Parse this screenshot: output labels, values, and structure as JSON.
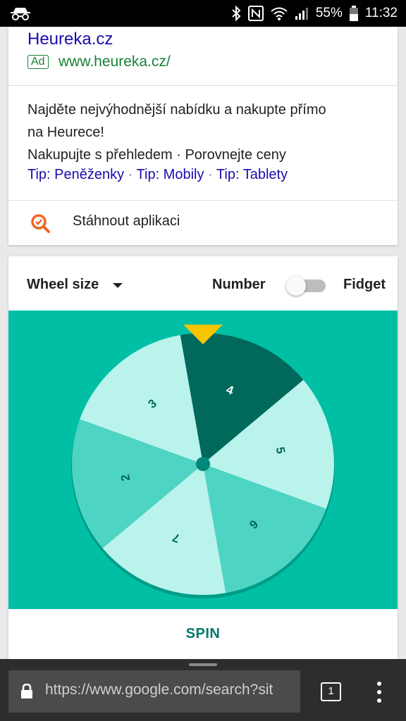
{
  "status_bar": {
    "battery": "55%",
    "time": "11:32",
    "icons": [
      "incognito-icon",
      "bluetooth-icon",
      "nfc-icon",
      "wifi-icon",
      "signal-icon",
      "battery-icon"
    ]
  },
  "ad": {
    "title": "Heureka.cz",
    "badge": "Ad",
    "url": "www.heureka.cz/",
    "description": [
      "Najděte nejvýhodnější nabídku a nakupte přímo",
      "na Heurece!",
      "Nakupujte s přehledem · Porovnejte ceny"
    ],
    "links": [
      "Tip: Peněženky",
      "Tip: Mobily",
      "Tip: Tablety"
    ],
    "link_separator": " · ",
    "app_link": "Stáhnout aplikaci",
    "app_icon": "heureka-search-icon"
  },
  "spinner": {
    "wheel_size_label": "Wheel size",
    "mode_number_label": "Number",
    "mode_fidget_label": "Fidget",
    "toggle_on": false,
    "spin_label": "SPIN",
    "pointer_color": "#f9c500",
    "background_color": "#00bfa5",
    "segments": [
      {
        "label": "4",
        "color": "#00695c",
        "text_color": "#ffffff"
      },
      {
        "label": "5",
        "color": "#b9f3ec",
        "text_color": "#00695c"
      },
      {
        "label": "6",
        "color": "#4dd4c3",
        "text_color": "#00695c"
      },
      {
        "label": "7",
        "color": "#b9f3ec",
        "text_color": "#00695c"
      },
      {
        "label": "2",
        "color": "#4dd4c3",
        "text_color": "#00695c"
      },
      {
        "label": "3",
        "color": "#b9f3ec",
        "text_color": "#00695c"
      }
    ],
    "rotation_deg": -10
  },
  "browser": {
    "url": "https://www.google.com/search?sit",
    "tab_count": "1"
  }
}
